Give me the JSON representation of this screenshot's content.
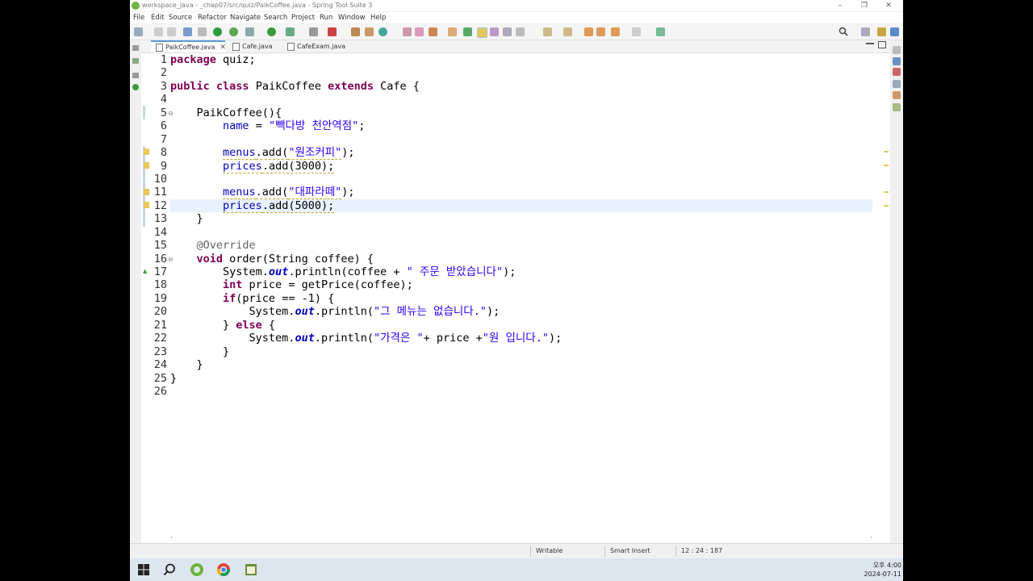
{
  "window": {
    "title": "workspace_java - _chap07/src/quiz/PaikCoffee.java - Spring Tool Suite 3",
    "controls": [
      "–",
      "❐",
      "✕"
    ]
  },
  "menu": [
    "File",
    "Edit",
    "Source",
    "Refactor",
    "Navigate",
    "Search",
    "Project",
    "Run",
    "Window",
    "Help"
  ],
  "tabs": [
    {
      "label": "PaikCoffee.java",
      "close": "✕"
    },
    {
      "label": "Cafe.java"
    },
    {
      "label": "CafeExam.java"
    }
  ],
  "line_numbers": [
    "1",
    "2",
    "3",
    "4",
    "5",
    "6",
    "7",
    "8",
    "9",
    "10",
    "11",
    "12",
    "13",
    "14",
    "15",
    "16",
    "17",
    "18",
    "19",
    "20",
    "21",
    "22",
    "23",
    "24",
    "25",
    "26"
  ],
  "code": {
    "l1a": "package",
    "l1b": " quiz;",
    "l3a": "public",
    "l3b": "class",
    "l3c": " PaikCoffee ",
    "l3d": "extends",
    "l3e": " Cafe {",
    "l5": "    PaikCoffee(){",
    "l6a": "        ",
    "l6b": "name",
    "l6c": " = ",
    "l6d": "\"빽다방 천안역점\"",
    "l6e": ";",
    "l8a": "        ",
    "l8b": "menus",
    "l8c": ".add(",
    "l8d": "\"원조커피\"",
    "l8e": ");",
    "l9a": "        ",
    "l9b": "prices",
    "l9c": ".add(3000);",
    "l11a": "        ",
    "l11b": "menus",
    "l11c": ".add(",
    "l11d": "\"대파라떼\"",
    "l11e": ");",
    "l12a": "        ",
    "l12b": "prices",
    "l12c": ".add(5000);",
    "l13": "    }",
    "l15a": "    ",
    "l15b": "@Override",
    "l16a": "    ",
    "l16b": "void",
    "l16c": " order(String coffee) {",
    "l17a": "        System.",
    "l17b": "out",
    "l17c": ".println(coffee + ",
    "l17d": "\" 주문 받았습니다\"",
    "l17e": ");",
    "l18a": "        ",
    "l18b": "int",
    "l18c": " price = getPrice(coffee);",
    "l19a": "        ",
    "l19b": "if",
    "l19c": "(price == -1) {",
    "l20a": "            System.",
    "l20b": "out",
    "l20c": ".println(",
    "l20d": "\"그 메뉴는 없습니다.\"",
    "l20e": ");",
    "l21a": "        } ",
    "l21b": "else",
    "l21c": " {",
    "l22a": "            System.",
    "l22b": "out",
    "l22c": ".println(",
    "l22d": "\"가격은 \"",
    "l22e": "+ price +",
    "l22f": "\"원 입니다.\"",
    "l22g": ");",
    "l23": "        }",
    "l24": "    }",
    "l25": "}"
  },
  "status": {
    "writable": "Writable",
    "insert_mode": "Smart Insert",
    "position": "12 : 24 : 187"
  },
  "clock": {
    "time": "오후 4:00",
    "date": "2024-07-11"
  },
  "colors": {
    "keyword": "#7f0055",
    "string": "#2a00ff",
    "field": "#0000c0",
    "annotation": "#646464",
    "current_line": "#e8f2fe"
  },
  "icons": [
    "search-icon",
    "windows-start-icon",
    "taskbar-search-icon",
    "sts-icon",
    "chrome-icon",
    "notepad-icon"
  ]
}
